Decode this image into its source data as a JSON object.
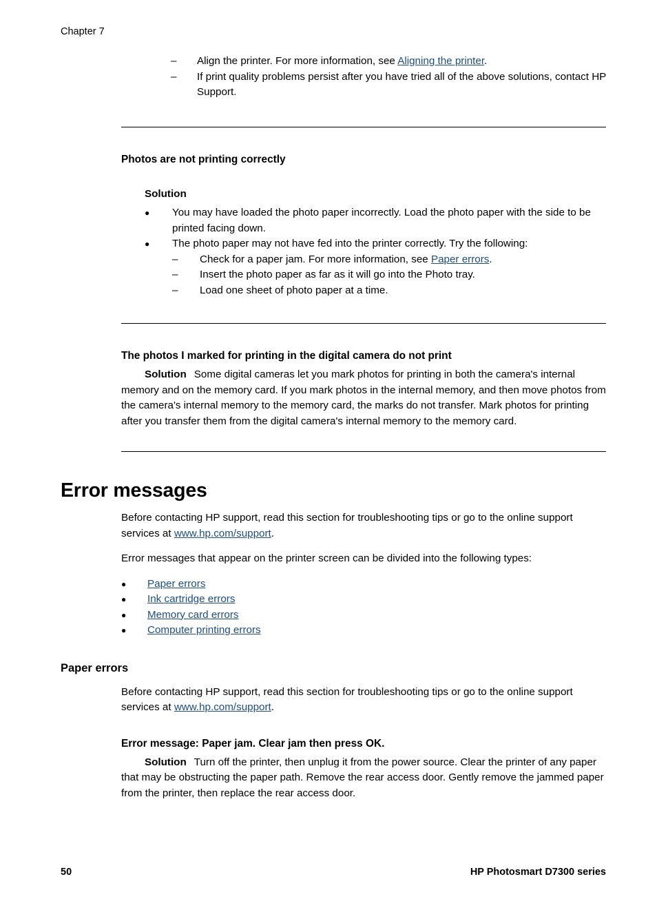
{
  "header": {
    "chapter": "Chapter 7"
  },
  "top_list": {
    "marker": "–",
    "items": [
      {
        "pre": "Align the printer. For more information, see ",
        "link": "Aligning the printer",
        "post": "."
      },
      {
        "pre": "If print quality problems persist after you have tried all of the above solutions, contact HP Support.",
        "link": "",
        "post": ""
      }
    ]
  },
  "section_photos": {
    "heading": "Photos are not printing correctly",
    "solution_label": "Solution",
    "bullet_marker": "●",
    "dash_marker": "–",
    "bullets": [
      {
        "text": "You may have loaded the photo paper incorrectly. Load the photo paper with the side to be printed facing down."
      },
      {
        "text": "The photo paper may not have fed into the printer correctly. Try the following:"
      }
    ],
    "sub_items": [
      {
        "pre": "Check for a paper jam. For more information, see ",
        "link": "Paper errors",
        "post": "."
      },
      {
        "pre": "Insert the photo paper as far as it will go into the Photo tray.",
        "link": "",
        "post": ""
      },
      {
        "pre": "Load one sheet of photo paper at a time.",
        "link": "",
        "post": ""
      }
    ]
  },
  "section_camera": {
    "heading": "The photos I marked for printing in the digital camera do not print",
    "solution_label": "Solution",
    "solution_text": "Some digital cameras let you mark photos for printing in both the camera's internal memory and on the memory card. If you mark photos in the internal memory, and then move photos from the camera's internal memory to the memory card, the marks do not transfer. Mark photos for printing after you transfer them from the digital camera's internal memory to the memory card."
  },
  "section_error_messages": {
    "heading": "Error messages",
    "intro_pre": "Before contacting HP support, read this section for troubleshooting tips or go to the online support services at ",
    "intro_link": "www.hp.com/support",
    "intro_post": ".",
    "types_intro": "Error messages that appear on the printer screen can be divided into the following types:",
    "bullet_marker": "●",
    "links": [
      "Paper errors",
      "Ink cartridge errors",
      "Memory card errors",
      "Computer printing errors"
    ]
  },
  "section_paper_errors": {
    "heading": "Paper errors",
    "intro_pre": "Before contacting HP support, read this section for troubleshooting tips or go to the online support services at ",
    "intro_link": "www.hp.com/support",
    "intro_post": ".",
    "error_heading": "Error message: Paper jam. Clear jam then press OK.",
    "solution_label": "Solution",
    "solution_text": "Turn off the printer, then unplug it from the power source. Clear the printer of any paper that may be obstructing the paper path. Remove the rear access door. Gently remove the jammed paper from the printer, then replace the rear access door."
  },
  "footer": {
    "page_number": "50",
    "product": "HP Photosmart D7300 series"
  },
  "colors": {
    "link": "#1d4e7c",
    "text": "#000000",
    "background": "#ffffff"
  }
}
